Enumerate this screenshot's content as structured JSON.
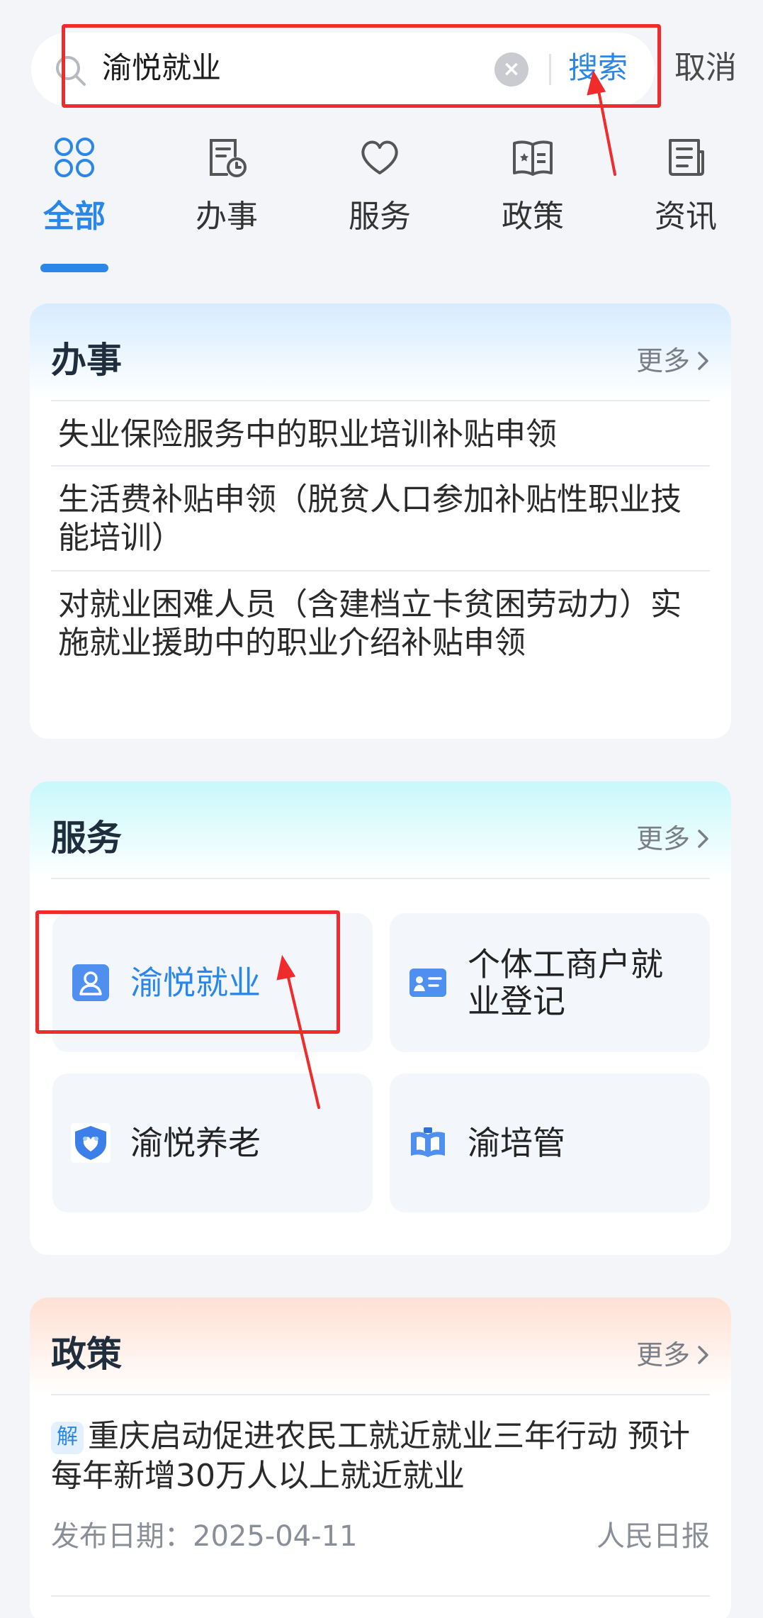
{
  "search": {
    "query": "渝悦就业",
    "submit_label": "搜索",
    "cancel_label": "取消"
  },
  "tabs": [
    {
      "label": "全部",
      "icon": "grid-clover-icon",
      "active": true
    },
    {
      "label": "办事",
      "icon": "document-clock-icon",
      "active": false
    },
    {
      "label": "服务",
      "icon": "heart-icon",
      "active": false
    },
    {
      "label": "政策",
      "icon": "book-star-icon",
      "active": false
    },
    {
      "label": "资讯",
      "icon": "news-icon",
      "active": false
    }
  ],
  "ban": {
    "title": "办事",
    "more": "更多",
    "items": [
      "失业保险服务中的职业培训补贴申领",
      "生活费补贴申领（脱贫人口参加补贴性职业技能培训）",
      "对就业困难人员（含建档立卡贫困劳动力）实施就业援助中的职业介绍补贴申领"
    ]
  },
  "services": {
    "title": "服务",
    "more": "更多",
    "tiles": [
      {
        "label": "渝悦就业",
        "icon": "people-card-icon",
        "highlight": true
      },
      {
        "label": "个体工商户就业登记",
        "icon": "id-card-icon",
        "highlight": false
      },
      {
        "label": "渝悦养老",
        "icon": "shield-people-icon",
        "highlight": false
      },
      {
        "label": "渝培管",
        "icon": "open-book-icon",
        "highlight": false
      }
    ]
  },
  "policy": {
    "title": "政策",
    "more": "更多",
    "items": [
      {
        "badge": "解",
        "title": "重庆启动促进农民工就近就业三年行动 预计每年新增30万人以上就近就业",
        "date_label": "发布日期：",
        "date": "2025-04-11",
        "source": "人民日报"
      }
    ]
  },
  "colors": {
    "accent": "#2a87e8",
    "annotation": "#ef2b2b",
    "background": "#f3f5f9"
  }
}
